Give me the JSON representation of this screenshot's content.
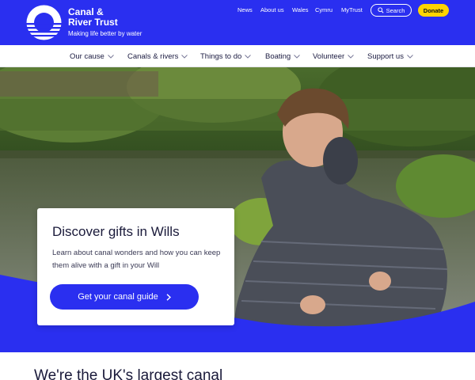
{
  "brand": {
    "name": "Canal &\nRiver Trust",
    "tagline": "Making life better by water",
    "logo_icon": "circle-water-logo"
  },
  "utility_nav": [
    {
      "label": "News"
    },
    {
      "label": "About us"
    },
    {
      "label": "Wales"
    },
    {
      "label": "Cymru"
    },
    {
      "label": "MyTrust"
    }
  ],
  "search": {
    "label": "Search",
    "icon": "search-icon"
  },
  "donate": {
    "label": "Donate"
  },
  "main_nav": [
    {
      "label": "Our cause"
    },
    {
      "label": "Canals & rivers"
    },
    {
      "label": "Things to do"
    },
    {
      "label": "Boating"
    },
    {
      "label": "Volunteer"
    },
    {
      "label": "Support us"
    }
  ],
  "promo": {
    "title": "Discover gifts in Wills",
    "text": "Learn about canal wonders and how you can keep them alive with a gift in your Will",
    "cta_label": "Get your canal guide"
  },
  "intro": {
    "heading": "We're the UK's largest canal"
  },
  "colors": {
    "brand_blue": "#2a2ff0",
    "donate_yellow": "#ffd400"
  }
}
